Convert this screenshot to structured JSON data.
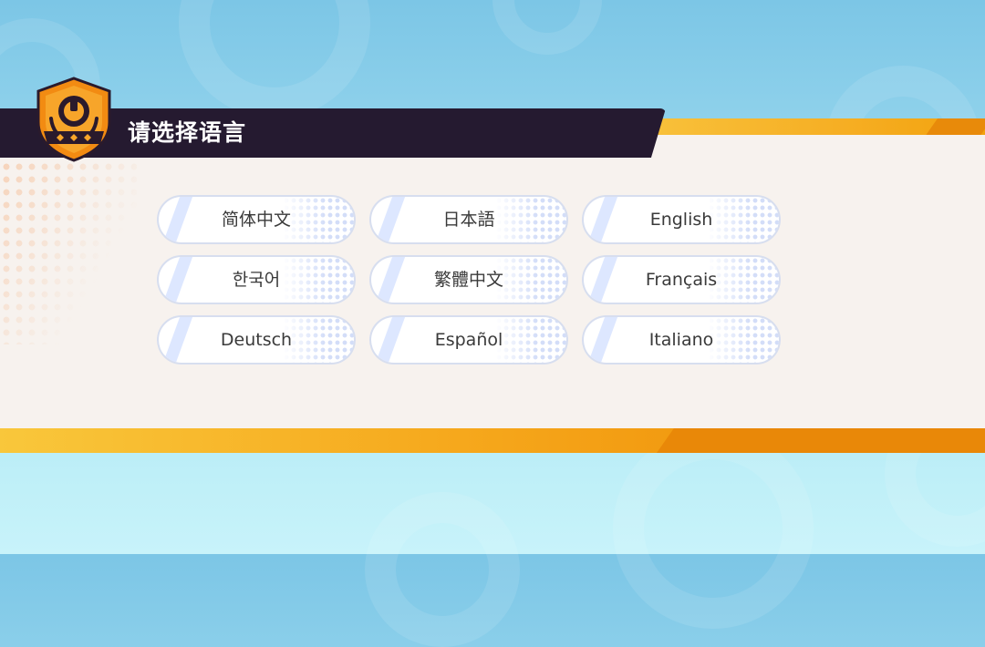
{
  "header": {
    "title": "请选择语言",
    "emblem_icon": "unite-emblem-icon"
  },
  "colors": {
    "header_bar": "#251a30",
    "accent_orange": "#f6ae23",
    "panel": "#f7f2ee",
    "sky": "#9ad8ee"
  },
  "languages": [
    {
      "label": "简体中文"
    },
    {
      "label": "日本語"
    },
    {
      "label": "English"
    },
    {
      "label": "한국어"
    },
    {
      "label": "繁體中文"
    },
    {
      "label": "Français"
    },
    {
      "label": "Deutsch"
    },
    {
      "label": "Español"
    },
    {
      "label": "Italiano"
    }
  ]
}
